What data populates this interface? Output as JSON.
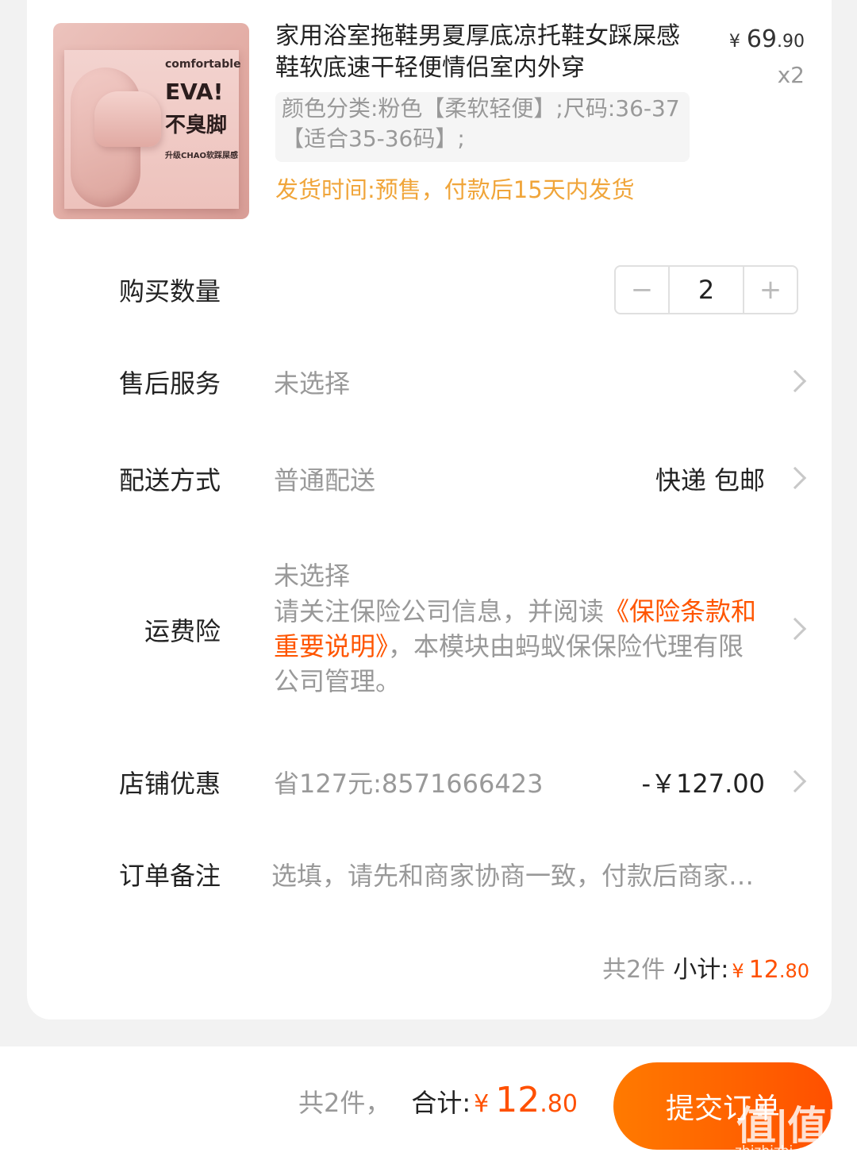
{
  "product": {
    "image_text": {
      "line1": "comfortable",
      "line2": "EVA!",
      "line3": "不臭脚",
      "line4": "升级CHAO软踩屎感"
    },
    "title": "家用浴室拖鞋男夏厚底凉托鞋女踩屎感鞋软底速干轻便情侣室内外穿",
    "price_currency": "¥",
    "price_int": "69",
    "price_dec": ".90",
    "quantity_label": "x2",
    "spec": "颜色分类:粉色【柔软轻便】;尺码:36-37【适合35-36码】;",
    "ship_time": "发货时间:预售，付款后15天内发货"
  },
  "rows": {
    "quantity": {
      "label": "购买数量",
      "minus": "−",
      "value": "2",
      "plus": "+"
    },
    "after_sales": {
      "label": "售后服务",
      "value": "未选择"
    },
    "delivery": {
      "label": "配送方式",
      "value": "普通配送",
      "right": "快递 包邮"
    },
    "insurance": {
      "label": "运费险",
      "status": "未选择",
      "text_before": "请关注保险公司信息，并阅读",
      "link": "《保险条款和重要说明》",
      "text_after": "，本模块由蚂蚁保保险代理有限公司管理。"
    },
    "shop_discount": {
      "label": "店铺优惠",
      "value": "省127元:8571666423",
      "right": "-￥127.00"
    },
    "note": {
      "label": "订单备注",
      "placeholder": "选填，请先和商家协商一致，付款后商家…"
    }
  },
  "subtotal": {
    "count": "共2件",
    "label": "小计:",
    "currency": "¥",
    "int": "12",
    "dec": ".80"
  },
  "footer": {
    "count": "共2件，",
    "label": "合计:",
    "currency": "¥",
    "int": "12",
    "dec": ".80",
    "submit": "提交订单"
  },
  "watermark": {
    "text": "值|值|值",
    "site": "zhizhizhi.com"
  },
  "colors": {
    "accent": "#ff5000",
    "ship_time": "#f0a53a",
    "muted": "#999999"
  }
}
